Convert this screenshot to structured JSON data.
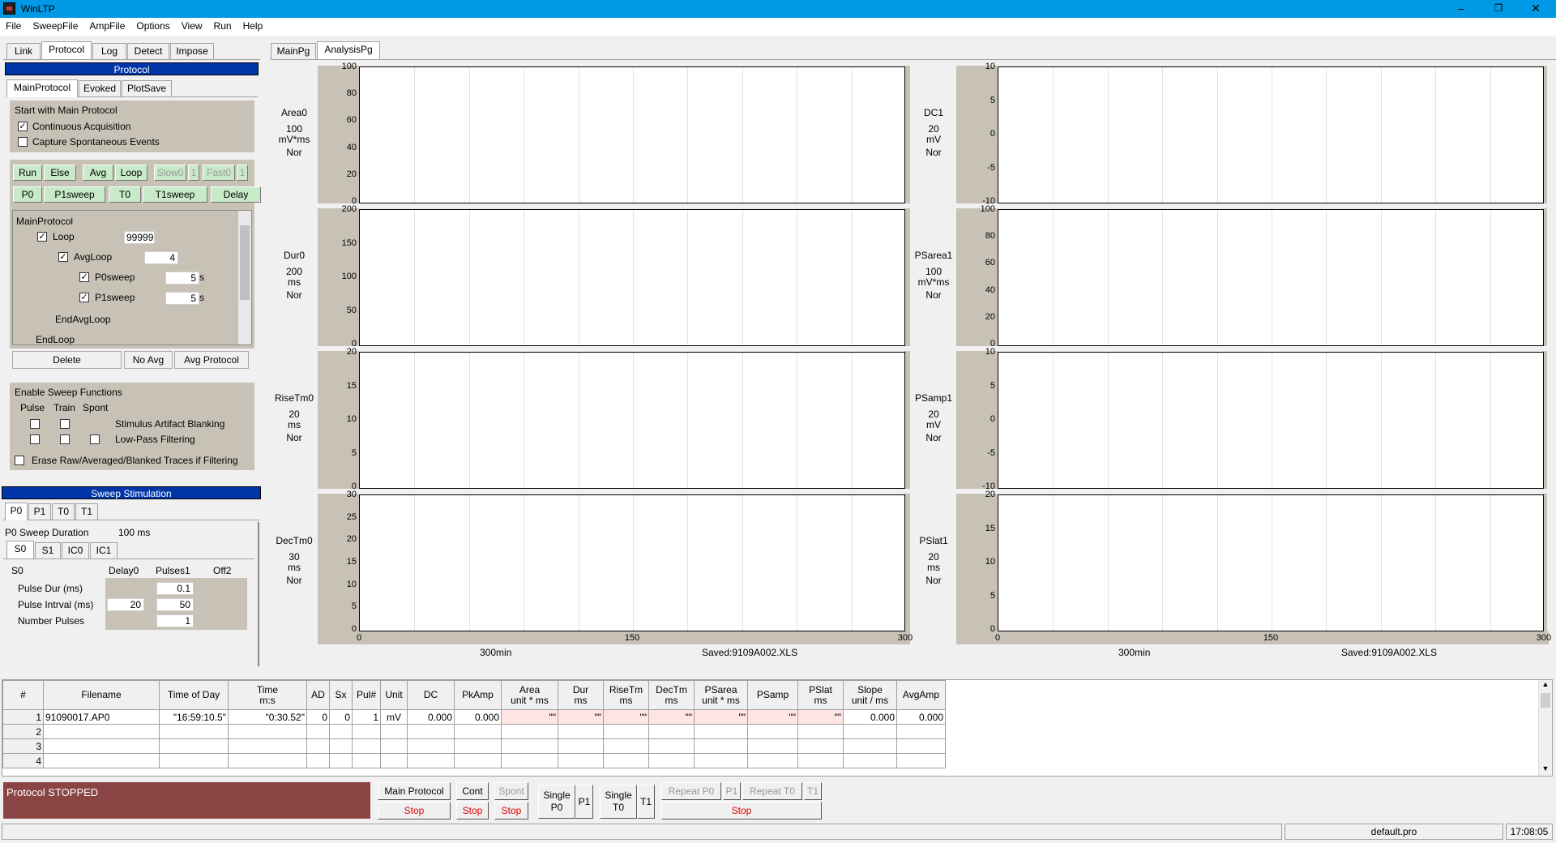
{
  "window": {
    "title": "WinLTP"
  },
  "menu": [
    "File",
    "SweepFile",
    "AmpFile",
    "Options",
    "View",
    "Run",
    "Help"
  ],
  "left_tabs": [
    "Link",
    "Protocol",
    "Log",
    "Detect",
    "Impose"
  ],
  "protocol_header": "Protocol",
  "sub_tabs": [
    "MainProtocol",
    "Evoked",
    "PlotSave"
  ],
  "start": {
    "title": "Start with Main Protocol",
    "continuous": "Continuous Acquisition",
    "capture": "Capture Spontaneous Events",
    "continuous_checked": true,
    "capture_checked": false
  },
  "green_buttons": {
    "run": "Run",
    "else": "Else",
    "avg": "Avg",
    "loop": "Loop",
    "slow0": "Slow0",
    "slow_n": "1",
    "fast0": "Fast0",
    "fast_n": "1",
    "p0": "P0",
    "p1sweep": "P1sweep",
    "t0": "T0",
    "t1sweep": "T1sweep",
    "delay": "Delay"
  },
  "tree": {
    "main": "MainProtocol",
    "loop": "Loop",
    "loop_val": "99999",
    "avgloop": "AvgLoop",
    "avgloop_val": "4",
    "p0sweep": "P0sweep",
    "p0_val": "5",
    "p1sweep": "P1sweep",
    "p1_val": "5",
    "unit_s": "s",
    "endavg": "EndAvgLoop",
    "endloop": "EndLoop"
  },
  "tree_buttons": {
    "delete": "Delete",
    "noavg": "No Avg",
    "avgprot": "Avg Protocol"
  },
  "sweepfn": {
    "title": "Enable Sweep Functions",
    "pulse": "Pulse",
    "train": "Train",
    "spont": "Spont",
    "artifact": "Stimulus Artifact Blanking",
    "lowpass": "Low-Pass Filtering",
    "erase": "Erase Raw/Averaged/Blanked Traces if Filtering"
  },
  "stim_header": "Sweep Stimulation",
  "stim_tabs": [
    "P0",
    "P1",
    "T0",
    "T1"
  ],
  "sweep_duration": {
    "label": "P0 Sweep Duration",
    "value": "100 ms"
  },
  "s_tabs": [
    "S0",
    "S1",
    "IC0",
    "IC1"
  ],
  "s0": {
    "title": "S0",
    "delay": "Delay0",
    "pulses": "Pulses1",
    "off": "Off2",
    "pulse_dur": "Pulse Dur (ms)",
    "pulse_dur_v": "0.1",
    "pulse_int": "Pulse Intrval (ms)",
    "pulse_int_d": "20",
    "pulse_int_v": "50",
    "num_pulses": "Number Pulses",
    "num_pulses_v": "1"
  },
  "page_tabs": [
    "MainPg",
    "AnalysisPg"
  ],
  "plots_left": [
    {
      "name": "Area0",
      "scale": "100",
      "unit": "mV*ms",
      "mode": "Nor",
      "ticks": [
        "100",
        "80",
        "60",
        "40",
        "20",
        "0"
      ]
    },
    {
      "name": "Dur0",
      "scale": "200",
      "unit": "ms",
      "mode": "Nor",
      "ticks": [
        "200",
        "150",
        "100",
        "50",
        "0"
      ]
    },
    {
      "name": "RiseTm0",
      "scale": "20",
      "unit": "ms",
      "mode": "Nor",
      "ticks": [
        "20",
        "15",
        "10",
        "5",
        "0"
      ]
    },
    {
      "name": "DecTm0",
      "scale": "30",
      "unit": "ms",
      "mode": "Nor",
      "ticks": [
        "30",
        "25",
        "20",
        "15",
        "10",
        "5",
        "0"
      ]
    }
  ],
  "plots_right": [
    {
      "name": "DC1",
      "scale": "20",
      "unit": "mV",
      "mode": "Nor",
      "ticks": [
        "10",
        "5",
        "0",
        "-5",
        "-10"
      ]
    },
    {
      "name": "PSarea1",
      "scale": "100",
      "unit": "mV*ms",
      "mode": "Nor",
      "ticks": [
        "100",
        "80",
        "60",
        "40",
        "20",
        "0"
      ]
    },
    {
      "name": "PSamp1",
      "scale": "20",
      "unit": "mV",
      "mode": "Nor",
      "ticks": [
        "10",
        "5",
        "0",
        "-5",
        "-10"
      ]
    },
    {
      "name": "PSlat1",
      "scale": "20",
      "unit": "ms",
      "mode": "Nor",
      "ticks": [
        "20",
        "15",
        "10",
        "5",
        "0"
      ]
    }
  ],
  "xticks": [
    "0",
    "150",
    "300"
  ],
  "x_footer": {
    "duration": "300",
    "unit": "min",
    "saved": "Saved:9109A002.XLS"
  },
  "table": {
    "headers": [
      [
        "#",
        ""
      ],
      [
        "Filename",
        ""
      ],
      [
        "Time of Day",
        ""
      ],
      [
        "Time",
        "m:s"
      ],
      [
        "AD",
        ""
      ],
      [
        "Sx",
        ""
      ],
      [
        "Pul#",
        ""
      ],
      [
        "Unit",
        ""
      ],
      [
        "DC",
        ""
      ],
      [
        "PkAmp",
        ""
      ],
      [
        "Area",
        "unit * ms"
      ],
      [
        "Dur",
        "ms"
      ],
      [
        "RiseTm",
        "ms"
      ],
      [
        "DecTm",
        "ms"
      ],
      [
        "PSarea",
        "unit * ms"
      ],
      [
        "PSamp",
        ""
      ],
      [
        "PSlat",
        "ms"
      ],
      [
        "Slope",
        "unit / ms"
      ],
      [
        "AvgAmp",
        ""
      ]
    ],
    "row1": [
      "1",
      "91090017.AP0",
      "\"16:59:10.5\"",
      "\"0:30.52\"",
      "0",
      "0",
      "1",
      "mV",
      "0.000",
      "0.000",
      "\"\"",
      "\"\"",
      "\"\"",
      "\"\"",
      "\"\"",
      "\"\"",
      "\"\"",
      "0.000",
      "0.000"
    ],
    "empty_rows": [
      "2",
      "3",
      "4"
    ]
  },
  "status": "Protocol STOPPED",
  "bottom": {
    "main": "Main Protocol",
    "cont": "Cont",
    "spont": "Spont",
    "stop": "Stop",
    "single_p0": "Single",
    "p0": "P0",
    "p1": "P1",
    "single_t0": "Single",
    "t0": "T0",
    "t1": "T1",
    "repeat_p0": "Repeat P0",
    "rp1": "P1",
    "repeat_t0": "Repeat T0",
    "rt1": "T1"
  },
  "statusbar": {
    "file": "default.pro",
    "time": "17:08:05"
  }
}
